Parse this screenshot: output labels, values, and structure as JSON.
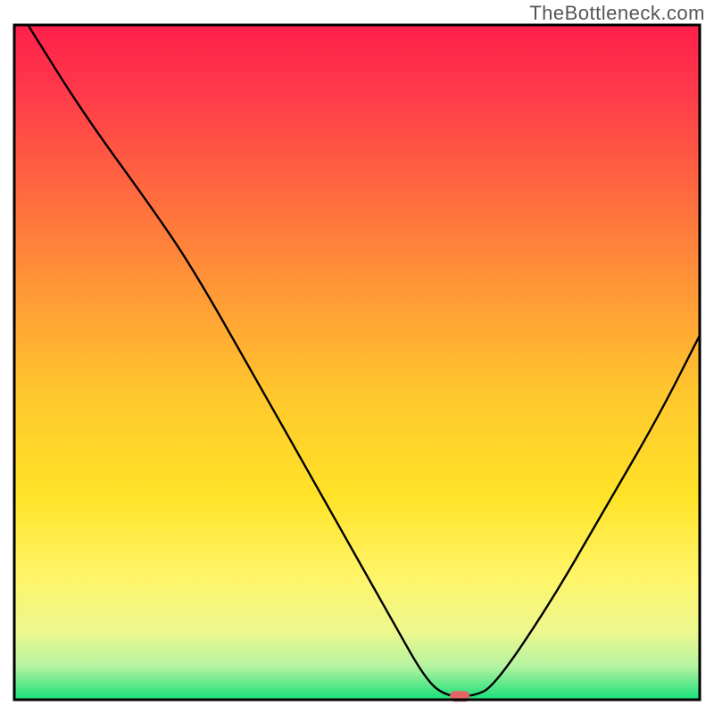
{
  "watermark": "TheBottleneck.com",
  "chart_data": {
    "type": "line",
    "title": "",
    "xlabel": "",
    "ylabel": "",
    "xlim": [
      0,
      100
    ],
    "ylim": [
      0,
      100
    ],
    "grid": false,
    "legend": false,
    "curve": [
      {
        "x": 2,
        "y": 100
      },
      {
        "x": 10,
        "y": 87
      },
      {
        "x": 20,
        "y": 73
      },
      {
        "x": 26,
        "y": 64
      },
      {
        "x": 35,
        "y": 48
      },
      {
        "x": 45,
        "y": 30
      },
      {
        "x": 55,
        "y": 12
      },
      {
        "x": 60,
        "y": 3
      },
      {
        "x": 63,
        "y": 0.5
      },
      {
        "x": 67,
        "y": 0.5
      },
      {
        "x": 70,
        "y": 2
      },
      {
        "x": 78,
        "y": 14
      },
      {
        "x": 86,
        "y": 28
      },
      {
        "x": 94,
        "y": 42
      },
      {
        "x": 100,
        "y": 54
      }
    ],
    "marker": {
      "x": 65,
      "y": 0.5,
      "color": "#e06666"
    },
    "background_gradient": [
      {
        "offset": 0.0,
        "color": "#ff1f4b"
      },
      {
        "offset": 0.1,
        "color": "#ff3a4a"
      },
      {
        "offset": 0.25,
        "color": "#ff6a3f"
      },
      {
        "offset": 0.4,
        "color": "#ff9a36"
      },
      {
        "offset": 0.55,
        "color": "#ffc82d"
      },
      {
        "offset": 0.7,
        "color": "#ffe328"
      },
      {
        "offset": 0.82,
        "color": "#fff56a"
      },
      {
        "offset": 0.9,
        "color": "#ecf88f"
      },
      {
        "offset": 0.95,
        "color": "#b6f3a0"
      },
      {
        "offset": 1.0,
        "color": "#17e07a"
      }
    ],
    "border_color": "#000000"
  }
}
